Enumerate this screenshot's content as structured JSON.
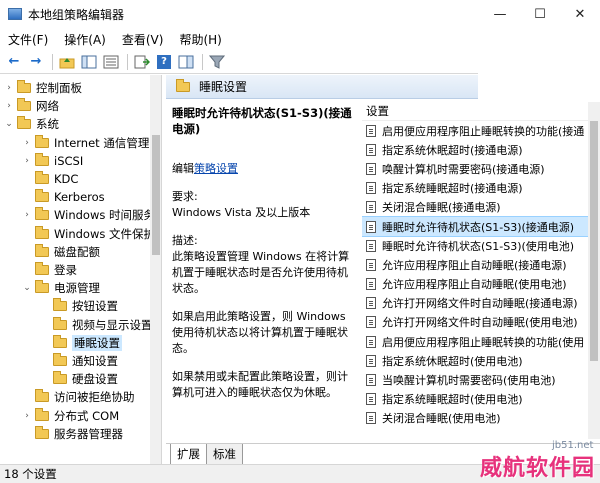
{
  "window": {
    "title": "本地组策略编辑器",
    "minimize": "—",
    "maximize": "☐",
    "close": "✕"
  },
  "menu": [
    "文件(F)",
    "操作(A)",
    "查看(V)",
    "帮助(H)"
  ],
  "toolbar": {
    "back": "←",
    "forward": "→",
    "help": "?"
  },
  "tree": [
    {
      "label": "控制面板",
      "indent": 0,
      "expanded": false
    },
    {
      "label": "网络",
      "indent": 0,
      "expanded": false
    },
    {
      "label": "系统",
      "indent": 0,
      "expanded": true
    },
    {
      "label": "Internet 通信管理",
      "indent": 1,
      "expanded": false
    },
    {
      "label": "iSCSI",
      "indent": 1,
      "expanded": false
    },
    {
      "label": "KDC",
      "indent": 1,
      "expanded": null
    },
    {
      "label": "Kerberos",
      "indent": 1,
      "expanded": null
    },
    {
      "label": "Windows 时间服务",
      "indent": 1,
      "expanded": false
    },
    {
      "label": "Windows 文件保护",
      "indent": 1,
      "expanded": null
    },
    {
      "label": "磁盘配额",
      "indent": 1,
      "expanded": null
    },
    {
      "label": "登录",
      "indent": 1,
      "expanded": null
    },
    {
      "label": "电源管理",
      "indent": 1,
      "expanded": true
    },
    {
      "label": "按钮设置",
      "indent": 2,
      "expanded": null
    },
    {
      "label": "视频与显示设置",
      "indent": 2,
      "expanded": null
    },
    {
      "label": "睡眠设置",
      "indent": 2,
      "expanded": null,
      "selected": true
    },
    {
      "label": "通知设置",
      "indent": 2,
      "expanded": null
    },
    {
      "label": "硬盘设置",
      "indent": 2,
      "expanded": null
    },
    {
      "label": "访问被拒绝协助",
      "indent": 1,
      "expanded": null
    },
    {
      "label": "分布式 COM",
      "indent": 1,
      "expanded": false
    },
    {
      "label": "服务器管理器",
      "indent": 1,
      "expanded": null
    }
  ],
  "main": {
    "header": "睡眠设置",
    "description": {
      "title": "睡眠时允许待机状态(S1-S3)(接通电源)",
      "edit_prefix": "编辑",
      "edit_link": "策略设置",
      "requirements_label": "要求:",
      "requirements_value": "Windows Vista 及以上版本",
      "desc_label": "描述:",
      "desc_text": "此策略设置管理 Windows 在将计算机置于睡眠状态时是否允许使用待机状态。",
      "enabled_text": "如果启用此策略设置，则 Windows 使用待机状态以将计算机置于睡眠状态。",
      "disabled_text": "如果禁用或未配置此策略设置，则计算机可进入的睡眠状态仅为休眠。"
    },
    "list_header": "设置",
    "settings": [
      "启用便应用程序阻止睡眠转换的功能(接通",
      "指定系统休眠超时(接通电源)",
      "唤醒计算机时需要密码(接通电源)",
      "指定系统睡眠超时(接通电源)",
      "关闭混合睡眠(接通电源)",
      "睡眠时允许待机状态(S1-S3)(接通电源)",
      "睡眠时允许待机状态(S1-S3)(使用电池)",
      "允许应用程序阻止自动睡眠(接通电源)",
      "允许应用程序阻止自动睡眠(使用电池)",
      "允许打开网络文件时自动睡眠(接通电源)",
      "允许打开网络文件时自动睡眠(使用电池)",
      "启用便应用程序阻止睡眠转换的功能(使用",
      "指定系统休眠超时(使用电池)",
      "当唤醒计算机时需要密码(使用电池)",
      "指定系统睡眠超时(使用电池)",
      "关闭混合睡眠(使用电池)"
    ],
    "selected_index": 5,
    "tabs": [
      "扩展",
      "标准"
    ]
  },
  "status": "18 个设置",
  "watermarks": {
    "site": "jb51.net",
    "brand": "威航软件园"
  }
}
